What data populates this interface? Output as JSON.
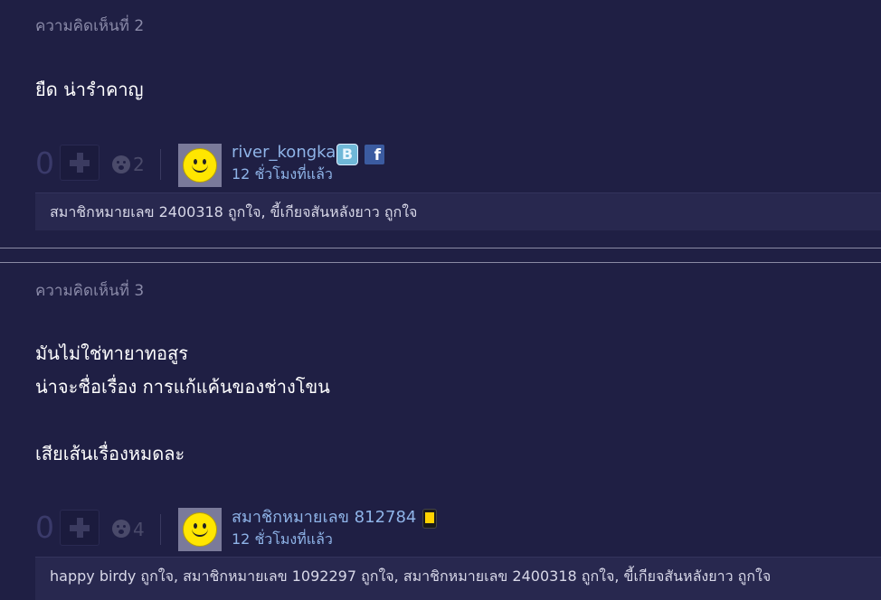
{
  "comments": [
    {
      "label": "ความคิดเห็นที่ 2",
      "body_lines": [
        "ยืด น่ารำคาญ"
      ],
      "vote_count": "0",
      "emotion_count": "2",
      "username": "river_kongka",
      "timestamp": "12 ชั่วโมงที่แล้ว",
      "badges": [
        "blog-badge-icon",
        "facebook-icon"
      ],
      "likes": "สมาชิกหมายเลข 2400318 ถูกใจ, ขี้เกียจสันหลังยาว ถูกใจ"
    },
    {
      "label": "ความคิดเห็นที่ 3",
      "body_lines": [
        "มันไม่ใช่ทายาทอสูร",
        "น่าจะชื่อเรื่อง การแก้แค้นของช่างโขน",
        "",
        "เสียเส้นเรื่องหมดละ"
      ],
      "vote_count": "0",
      "emotion_count": "4",
      "username": "สมาชิกหมายเลข 812784",
      "timestamp": "12 ชั่วโมงที่แล้ว",
      "badges": [
        "mobile-phone-icon"
      ],
      "likes": "happy birdy ถูกใจ, สมาชิกหมายเลข 1092297 ถูกใจ, สมาชิกหมายเลข 2400318 ถูกใจ, ขี้เกียจสันหลังยาว ถูกใจ"
    }
  ],
  "icons": {
    "blog_badge_letter": "B",
    "facebook_letter": "f"
  },
  "colors": {
    "background": "#1f1f44",
    "link": "#8fb4e8",
    "muted": "#8a8aa8",
    "likes_box": "#28284f"
  }
}
